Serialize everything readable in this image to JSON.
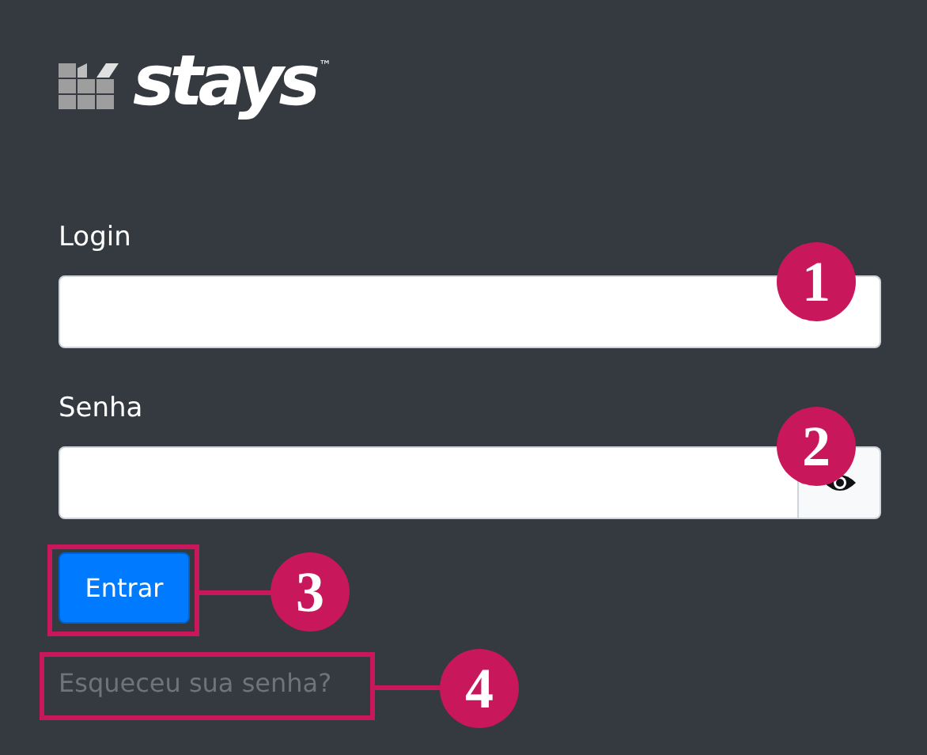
{
  "logo": {
    "text": "stays",
    "trademark": "™"
  },
  "form": {
    "fields": [
      {
        "label": "Login",
        "kind": "text"
      },
      {
        "label": "Senha",
        "kind": "password"
      }
    ],
    "submit_button": "Entrar",
    "forgot_link": "Esqueceu sua senha?"
  },
  "annotations": [
    {
      "number": "1",
      "frame": false
    },
    {
      "number": "2",
      "frame": false
    },
    {
      "number": "3",
      "frame": true
    },
    {
      "number": "4",
      "frame": true
    }
  ]
}
